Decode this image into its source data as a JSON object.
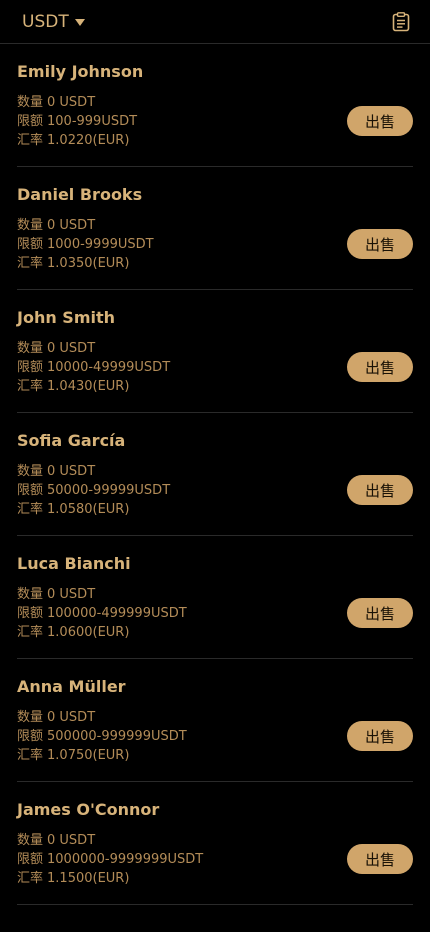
{
  "header": {
    "currency": "USDT",
    "history_icon": "clipboard-list-icon"
  },
  "labels": {
    "quantity": "数量",
    "limit": "限额",
    "rate": "汇率",
    "sell": "出售"
  },
  "offers": [
    {
      "name": "Emily Johnson",
      "quantity": "0 USDT",
      "limit": "100-999USDT",
      "rate": "1.0220(EUR)"
    },
    {
      "name": "Daniel Brooks",
      "quantity": "0 USDT",
      "limit": "1000-9999USDT",
      "rate": "1.0350(EUR)"
    },
    {
      "name": "John Smith",
      "quantity": "0 USDT",
      "limit": "10000-49999USDT",
      "rate": "1.0430(EUR)"
    },
    {
      "name": "Sofia García",
      "quantity": "0 USDT",
      "limit": "50000-99999USDT",
      "rate": "1.0580(EUR)"
    },
    {
      "name": "Luca Bianchi",
      "quantity": "0 USDT",
      "limit": "100000-499999USDT",
      "rate": "1.0600(EUR)"
    },
    {
      "name": "Anna Müller",
      "quantity": "0 USDT",
      "limit": "500000-999999USDT",
      "rate": "1.0750(EUR)"
    },
    {
      "name": "James O'Connor",
      "quantity": "0 USDT",
      "limit": "1000000-9999999USDT",
      "rate": "1.1500(EUR)"
    }
  ],
  "colors": {
    "background": "#000000",
    "accent": "#d0a56a",
    "text": "#d7b37a",
    "divider": "#2a2a2a"
  }
}
